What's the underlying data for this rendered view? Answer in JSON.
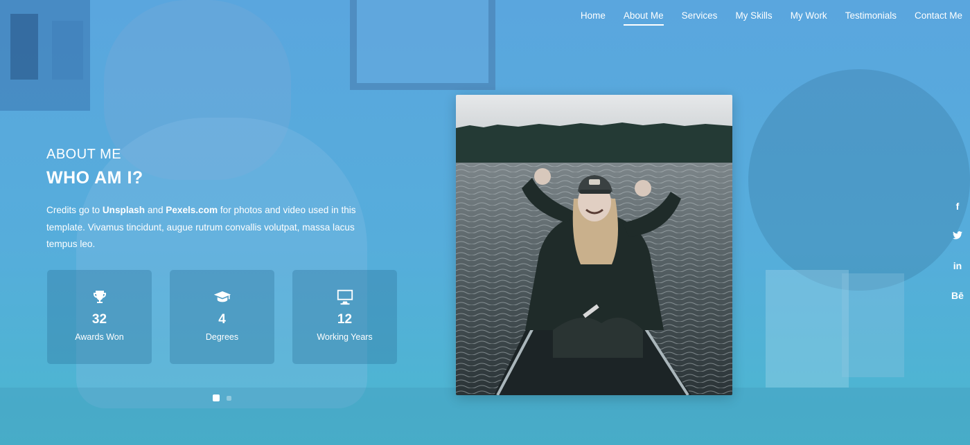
{
  "nav": {
    "items": [
      {
        "label": "Home",
        "active": false
      },
      {
        "label": "About Me",
        "active": true
      },
      {
        "label": "Services",
        "active": false
      },
      {
        "label": "My Skills",
        "active": false
      },
      {
        "label": "My Work",
        "active": false
      },
      {
        "label": "Testimonials",
        "active": false
      },
      {
        "label": "Contact Me",
        "active": false
      }
    ]
  },
  "about": {
    "label": "ABOUT ME",
    "title": "WHO AM I?",
    "text_prefix": "Credits go to ",
    "unsplash": "Unsplash",
    "and": " and ",
    "pexels": "Pexels.com",
    "text_suffix": " for photos and video used in this template. Vivamus tincidunt, augue rutrum convallis volutpat, massa lacus tempus leo."
  },
  "stats": [
    {
      "icon": "trophy-icon",
      "value": "32",
      "label": "Awards Won"
    },
    {
      "icon": "graduation-cap-icon",
      "value": "4",
      "label": "Degrees"
    },
    {
      "icon": "desktop-icon",
      "value": "12",
      "label": "Working Years"
    }
  ],
  "carousel": {
    "pages": 2,
    "active": 1
  },
  "photo": {
    "icon": "person-in-canoe-photo"
  },
  "social": {
    "icons": [
      "facebook-icon",
      "twitter-icon",
      "linkedin-icon",
      "behance-icon"
    ],
    "facebook": "f",
    "linkedin": "in",
    "behance": "Bē"
  },
  "colors": {
    "background": "#5aa6de",
    "accent": "#ffffff",
    "card": "#2d7aa8"
  }
}
